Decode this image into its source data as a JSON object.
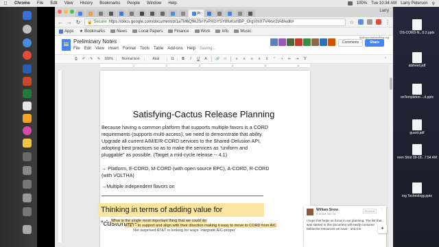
{
  "menubar": {
    "app": "Chrome",
    "items": [
      "File",
      "Edit",
      "View",
      "History",
      "Bookmarks",
      "People",
      "Window",
      "Help"
    ],
    "battery": "100%",
    "clock": "Tue 10:34 AM",
    "user": "Larry Peterson"
  },
  "chrome": {
    "active_tab": "Pr",
    "user": "Larry",
    "secure_label": "Secure",
    "url": "https://docs.google.com/document/d/1aTM6Q9kJSnYvPXGYSY8fuKsmBP_OrgVmX7V4xvr2IA8/edit#"
  },
  "bookmarks": [
    "Apps",
    "Bookmarks",
    "News",
    "Local Papers",
    "Finance",
    "Work",
    "Info",
    "Music"
  ],
  "docs": {
    "title": "Preliminary Notes",
    "menu": [
      "File",
      "Edit",
      "View",
      "Insert",
      "Format",
      "Tools",
      "Table",
      "Add-ons",
      "Help"
    ],
    "saving": "Saving...",
    "comments_label": "Comments",
    "share_label": "Share",
    "account": "llp@opennetworking.org"
  },
  "toolbar": {
    "zoom": "100%",
    "style": "Normal text",
    "font": "Arial",
    "size": "11"
  },
  "ruler": [
    "1",
    "2",
    "3",
    "4",
    "5",
    "6"
  ],
  "document": {
    "title": "Satisfying-Cactus Release Planning",
    "para1": "Because having a common platform that supports multiple favors is a CORD requirements (supports multi-access), we need to demonstrate that ability. Upgrade all current A/M/E/R-CORD services to the Shared-Delusion API, adopting best practices so as to make the services as “uniform and pluggable” as possible. (Target a mid-cycle release -- 4.1)",
    "para2": "→ Platform, E-CORD, M-CORD (with open source EPC), A-CORD, R-CORD (with VOLTHA)",
    "para3": "→Multiple independent flavors on",
    "heading2": "Thinking in terms of adding value for “customers”",
    "bullet1": "What is the single most important thing that we could do:",
    "bullet2": "AT&T - to support and align with their direction making it easy to move to CORD from AIC",
    "bullet3": "Not surprised AT&T is looking for ways ‘integrate AIC-proper’"
  },
  "comment": {
    "author": "William Snow",
    "time": "9:11 AM Sep 18",
    "resolve": "Resolve",
    "text": "I hope this helps us focus in our planning. The list that was started in this document will easily consume below the resources we have - and it is"
  },
  "desktop": [
    "OS-CORD-N...0.2.pptx",
    "atsheet.pdf",
    "onTempleton-...d.pptx",
    "guard.pdf",
    "reen Shot 09-18...7.54 AM",
    "ing Technology.pptx"
  ],
  "colors": {
    "docs_blue": "#4285f4",
    "highlight": "#fbe5a2"
  }
}
